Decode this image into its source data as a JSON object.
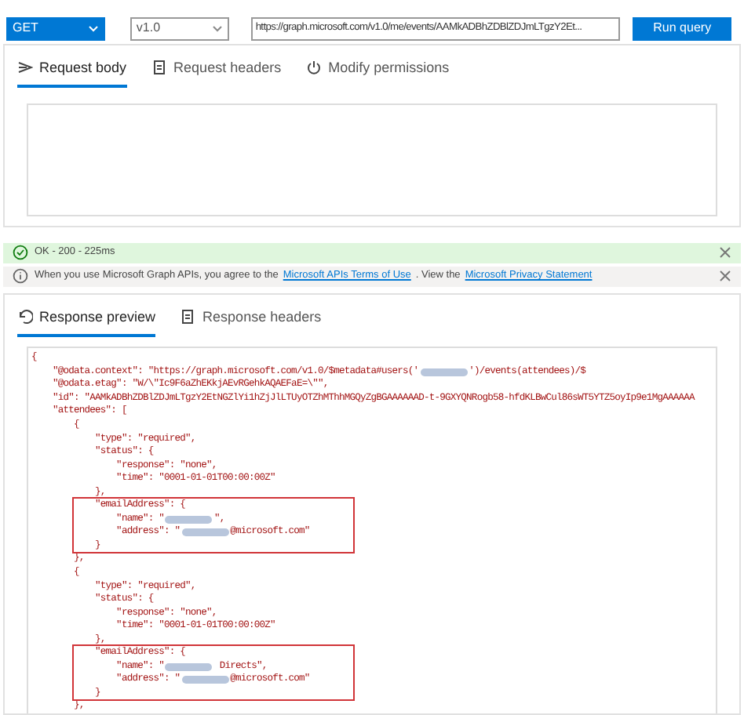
{
  "toolbar": {
    "method": "GET",
    "version": "v1.0",
    "url": "https://graph.microsoft.com/v1.0/me/events/AAMkADBhZDBlZDJmLTgzY2Et...",
    "run_button": "Run query"
  },
  "request_tabs": [
    {
      "label": "Request body",
      "selected": true
    },
    {
      "label": "Request headers",
      "selected": false
    },
    {
      "label": "Modify permissions",
      "selected": false
    }
  ],
  "messages": [
    {
      "kind": "success",
      "segments": [
        {
          "kind": "text",
          "text": "OK - 200 - 225ms"
        }
      ]
    },
    {
      "kind": "info",
      "segments": [
        {
          "kind": "text",
          "text": "When you use Microsoft Graph APIs, you agree to the"
        },
        {
          "kind": "link",
          "text": "Microsoft APIs Terms of Use"
        },
        {
          "kind": "text",
          "text": ". View the"
        },
        {
          "kind": "link",
          "text": "Microsoft Privacy Statement"
        }
      ]
    }
  ],
  "response_tabs": [
    {
      "label": "Response preview",
      "selected": true
    },
    {
      "label": "Response headers",
      "selected": false
    }
  ],
  "response_lines": [
    {
      "boxed": false,
      "segments": [
        {
          "kind": "text",
          "text": "{"
        }
      ]
    },
    {
      "boxed": false,
      "segments": [
        {
          "kind": "text",
          "text": "    \"@odata.context\": \"https://graph.microsoft.com/v1.0/$metadata#users('"
        },
        {
          "kind": "redacted"
        },
        {
          "kind": "text",
          "text": "')/events(attendees)/$"
        }
      ]
    },
    {
      "boxed": false,
      "segments": [
        {
          "kind": "text",
          "text": "    \"@odata.etag\": \"W/\\\"Ic9F6aZhEKkjAEvRGehkAQAEFaE=\\\"\","
        }
      ]
    },
    {
      "boxed": false,
      "segments": [
        {
          "kind": "text",
          "text": "    \"id\": \"AAMkADBhZDBlZDJmLTgzY2EtNGZlYi1hZjJlLTUyOTZhMThhMGQyZgBGAAAAAAD-t-9GXYQNRogb58-hfdKLBwCul86sWT5YTZ5oyIp9e1MgAAAAAA"
        }
      ]
    },
    {
      "boxed": false,
      "segments": [
        {
          "kind": "text",
          "text": "    \"attendees\": ["
        }
      ]
    },
    {
      "boxed": false,
      "segments": [
        {
          "kind": "text",
          "text": "        {"
        }
      ]
    },
    {
      "boxed": false,
      "segments": [
        {
          "kind": "text",
          "text": "            \"type\": \"required\","
        }
      ]
    },
    {
      "boxed": false,
      "segments": [
        {
          "kind": "text",
          "text": "            \"status\": {"
        }
      ]
    },
    {
      "boxed": false,
      "segments": [
        {
          "kind": "text",
          "text": "                \"response\": \"none\","
        }
      ]
    },
    {
      "boxed": false,
      "segments": [
        {
          "kind": "text",
          "text": "                \"time\": \"0001-01-01T00:00:00Z\""
        }
      ]
    },
    {
      "boxed": false,
      "segments": [
        {
          "kind": "text",
          "text": "            },"
        }
      ]
    },
    {
      "boxed": true,
      "segments": [
        {
          "kind": "text",
          "text": "            \"emailAddress\": {"
        }
      ]
    },
    {
      "boxed": true,
      "segments": [
        {
          "kind": "text",
          "text": "                \"name\": \""
        },
        {
          "kind": "redacted"
        },
        {
          "kind": "text",
          "text": "\","
        }
      ]
    },
    {
      "boxed": true,
      "segments": [
        {
          "kind": "text",
          "text": "                \"address\": \""
        },
        {
          "kind": "redacted"
        },
        {
          "kind": "text",
          "text": "@microsoft.com\""
        }
      ]
    },
    {
      "boxed": true,
      "segments": [
        {
          "kind": "text",
          "text": "            }"
        }
      ]
    },
    {
      "boxed": false,
      "segments": [
        {
          "kind": "text",
          "text": "        },"
        }
      ]
    },
    {
      "boxed": false,
      "segments": [
        {
          "kind": "text",
          "text": "        {"
        }
      ]
    },
    {
      "boxed": false,
      "segments": [
        {
          "kind": "text",
          "text": "            \"type\": \"required\","
        }
      ]
    },
    {
      "boxed": false,
      "segments": [
        {
          "kind": "text",
          "text": "            \"status\": {"
        }
      ]
    },
    {
      "boxed": false,
      "segments": [
        {
          "kind": "text",
          "text": "                \"response\": \"none\","
        }
      ]
    },
    {
      "boxed": false,
      "segments": [
        {
          "kind": "text",
          "text": "                \"time\": \"0001-01-01T00:00:00Z\""
        }
      ]
    },
    {
      "boxed": false,
      "segments": [
        {
          "kind": "text",
          "text": "            },"
        }
      ]
    },
    {
      "boxed": true,
      "segments": [
        {
          "kind": "text",
          "text": "            \"emailAddress\": {"
        }
      ]
    },
    {
      "boxed": true,
      "segments": [
        {
          "kind": "text",
          "text": "                \"name\": \""
        },
        {
          "kind": "redacted"
        },
        {
          "kind": "text",
          "text": " Directs\","
        }
      ]
    },
    {
      "boxed": true,
      "segments": [
        {
          "kind": "text",
          "text": "                \"address\": \""
        },
        {
          "kind": "redacted"
        },
        {
          "kind": "text",
          "text": "@microsoft.com\""
        }
      ]
    },
    {
      "boxed": true,
      "segments": [
        {
          "kind": "text",
          "text": "            }"
        }
      ]
    },
    {
      "boxed": false,
      "segments": [
        {
          "kind": "text",
          "text": "        },"
        }
      ]
    }
  ]
}
